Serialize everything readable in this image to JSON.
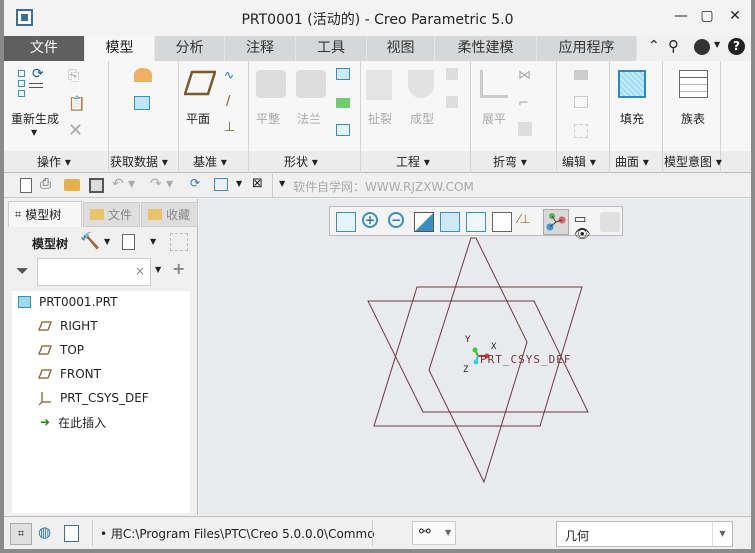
{
  "window": {
    "title": "PRT0001 (活动的) - Creo Parametric 5.0"
  },
  "tabs": [
    {
      "label": "文件"
    },
    {
      "label": "模型"
    },
    {
      "label": "分析"
    },
    {
      "label": "注释"
    },
    {
      "label": "工具"
    },
    {
      "label": "视图"
    },
    {
      "label": "柔性建模"
    },
    {
      "label": "应用程序"
    }
  ],
  "active_tab": "模型",
  "ribbon": {
    "buttons": {
      "regenerate": "重新生成",
      "plane": "平面",
      "flatten": "平整",
      "flange": "法兰",
      "rip": "扯裂",
      "form": "成型",
      "unbend": "展平",
      "fill": "填充",
      "family_table": "族表"
    },
    "groups": [
      "操作",
      "获取数据",
      "基准",
      "形状",
      "工程",
      "折弯",
      "编辑",
      "曲面",
      "模型意图"
    ]
  },
  "quick_access": {
    "watermark": "软件自学网：WWW.RJZXW.COM"
  },
  "left_panel": {
    "tabs": [
      "模型树",
      "文件",
      "收藏"
    ],
    "toolbar_label": "模型树",
    "filter_placeholder": "",
    "tree": [
      {
        "label": "PRT0001.PRT",
        "icon": "part-icon"
      },
      {
        "label": "RIGHT",
        "icon": "datum-plane-icon"
      },
      {
        "label": "TOP",
        "icon": "datum-plane-icon"
      },
      {
        "label": "FRONT",
        "icon": "datum-plane-icon"
      },
      {
        "label": "PRT_CSYS_DEF",
        "icon": "csys-icon"
      },
      {
        "label": "在此插入",
        "icon": "insert-here-icon"
      }
    ]
  },
  "graphics": {
    "csys_label": "PRT_CSYS_DEF",
    "axes": {
      "x": "X",
      "y": "Y",
      "z": "Z"
    },
    "datum_color": "#6b3a3f"
  },
  "status": {
    "message": "用C:\\Program Files\\PTC\\Creo 5.0.0.0\\Commo",
    "filter_value": "几何"
  }
}
